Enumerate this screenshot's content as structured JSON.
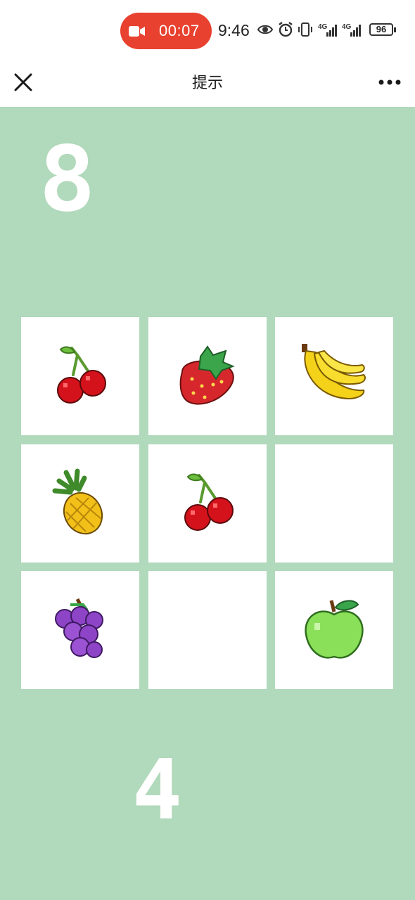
{
  "status_bar": {
    "recording_time": "00:07",
    "clock": "9:46",
    "network_1": "4G",
    "network_2": "4G",
    "battery": "96"
  },
  "nav": {
    "title": "提示",
    "close_icon": "close-icon",
    "more_icon": "more-icon"
  },
  "game": {
    "top_number": "8",
    "bottom_number": "4",
    "grid": [
      [
        "cherry",
        "strawberry",
        "banana"
      ],
      [
        "pineapple",
        "cherry",
        ""
      ],
      [
        "grape",
        "",
        "apple"
      ]
    ]
  },
  "colors": {
    "background": "#b1d9bb",
    "record_pill": "#e8412f",
    "tile": "#ffffff"
  }
}
